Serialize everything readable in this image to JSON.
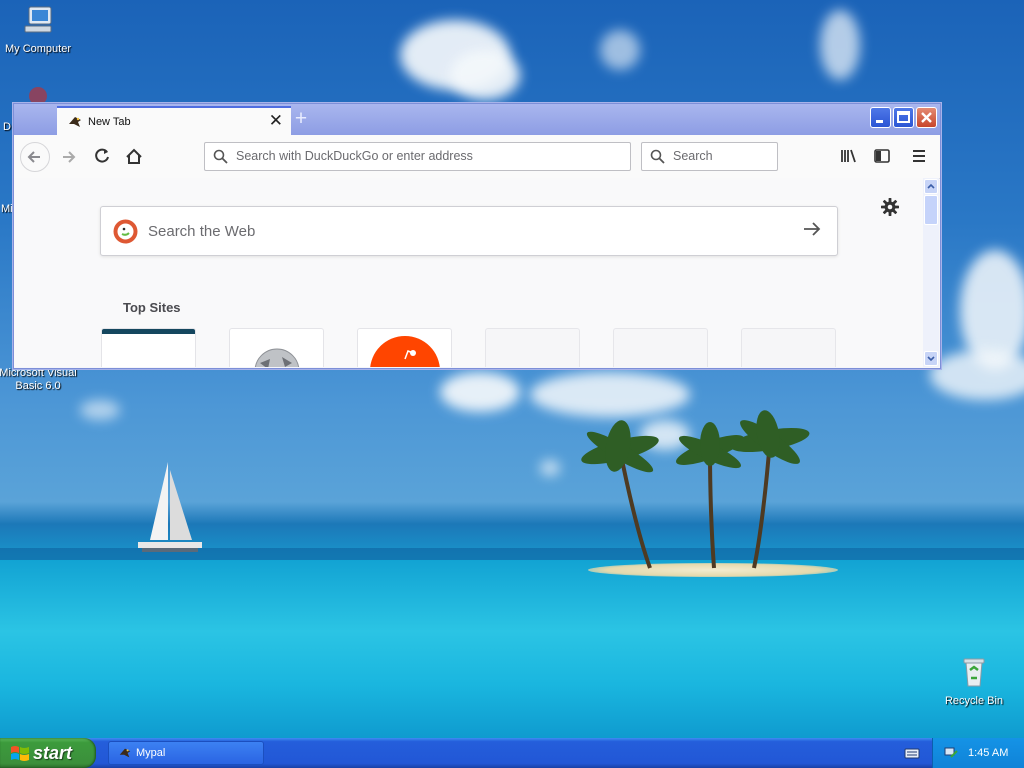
{
  "desktop": {
    "icons": [
      {
        "label": "My Computer"
      },
      {
        "label": "Microsoft Visual Basic 6.0"
      },
      {
        "label": "Recycle Bin"
      }
    ],
    "partial_labels": [
      "D",
      "Mi"
    ]
  },
  "browser": {
    "tab": {
      "title": "New Tab"
    },
    "urlbar": {
      "placeholder": "Search with DuckDuckGo or enter address"
    },
    "searchbar": {
      "placeholder": "Search"
    },
    "newtab_page": {
      "web_search_placeholder": "Search the Web",
      "top_sites_title": "Top Sites",
      "tile_count": 6
    }
  },
  "taskbar": {
    "start_label": "start",
    "tasks": [
      {
        "label": "Mypal"
      }
    ],
    "clock": "1:45 AM"
  },
  "colors": {
    "titlebar": "#8d9de4",
    "taskbar": "#245edb",
    "start": "#3c9b3c",
    "close_button": "#c8452a"
  }
}
